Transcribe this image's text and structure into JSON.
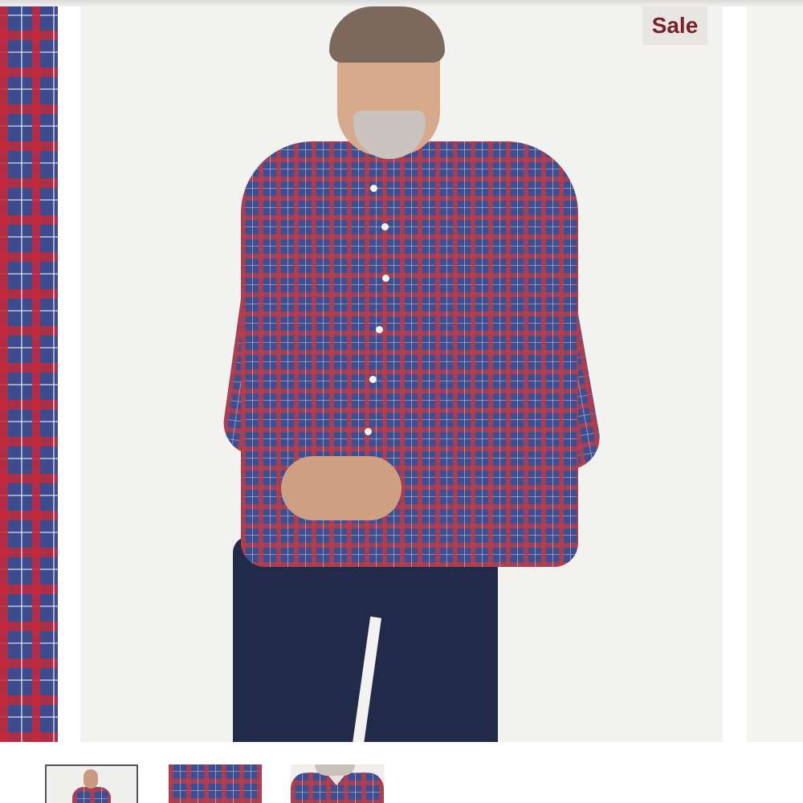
{
  "badge": {
    "label": "Sale",
    "color": "#7a1f2b"
  },
  "carousel": {
    "slides": [
      {
        "name": "previous-slide",
        "icon": "plaid-fabric-closeup"
      },
      {
        "name": "current-slide",
        "icon": "model-in-plaid-shirt"
      },
      {
        "name": "next-slide",
        "icon": "blank-backdrop"
      }
    ]
  },
  "thumbnails": [
    {
      "name": "thumbnail-1",
      "icon": "model-full-body",
      "selected": true
    },
    {
      "name": "thumbnail-2",
      "icon": "fabric-detail",
      "selected": false
    },
    {
      "name": "thumbnail-3",
      "icon": "collar-detail",
      "selected": false
    }
  ],
  "colors": {
    "shirt_blue": "#3d4f93",
    "shirt_red": "#be3c46",
    "jeans": "#222a4a"
  }
}
